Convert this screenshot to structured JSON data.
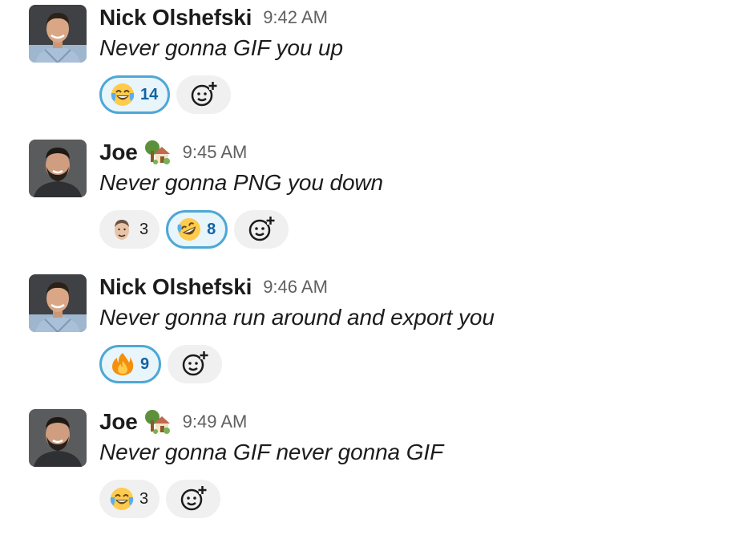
{
  "messages": [
    {
      "author": "Nick Olshefski",
      "time": "9:42 AM",
      "text": "Never gonna GIF you up",
      "status_emoji": "",
      "avatar": "avatar-nick",
      "reactions": [
        {
          "emoji": "joy-emoji",
          "count": "14",
          "mine": true
        }
      ]
    },
    {
      "author": "Joe",
      "time": "9:45 AM",
      "text": "Never gonna PNG you down",
      "status_emoji": "house-with-garden-emoji",
      "avatar": "avatar-joe",
      "reactions": [
        {
          "emoji": "face-custom-emoji",
          "count": "3",
          "mine": false
        },
        {
          "emoji": "rofl-emoji",
          "count": "8",
          "mine": true
        }
      ]
    },
    {
      "author": "Nick Olshefski",
      "time": "9:46 AM",
      "text": "Never gonna run around and export you",
      "status_emoji": "",
      "avatar": "avatar-nick",
      "reactions": [
        {
          "emoji": "fire-emoji",
          "count": "9",
          "mine": true
        }
      ]
    },
    {
      "author": "Joe",
      "time": "9:49 AM",
      "text": "Never gonna GIF never gonna GIF",
      "status_emoji": "house-with-garden-emoji",
      "avatar": "avatar-joe",
      "reactions": [
        {
          "emoji": "joy-emoji",
          "count": "3",
          "mine": false
        }
      ]
    }
  ],
  "colors": {
    "reaction_mine_border": "#4ea7d6",
    "reaction_mine_bg": "#e8f5fa",
    "reaction_bg": "#f0f0f0",
    "count_mine": "#1264a3",
    "timestamp": "#616061"
  },
  "add_reaction_icon": "add-reaction-icon"
}
